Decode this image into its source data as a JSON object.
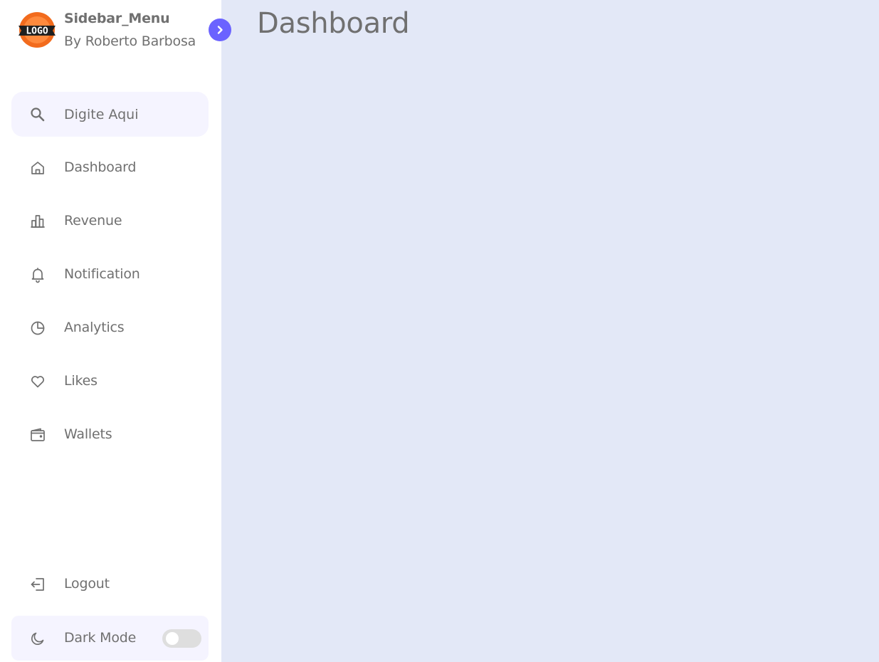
{
  "sidebar": {
    "brand": {
      "logo_text": "LOGO",
      "name": "Sidebar_Menu",
      "author": "By Roberto Barbosa"
    },
    "search": {
      "placeholder": "Digite Aqui",
      "icon": "search-icon"
    },
    "items": [
      {
        "label": "Dashboard",
        "icon": "home-icon"
      },
      {
        "label": "Revenue",
        "icon": "bar-chart-icon"
      },
      {
        "label": "Notification",
        "icon": "bell-icon"
      },
      {
        "label": "Analytics",
        "icon": "pie-chart-icon"
      },
      {
        "label": "Likes",
        "icon": "heart-icon"
      },
      {
        "label": "Wallets",
        "icon": "wallet-icon"
      }
    ],
    "logout": {
      "label": "Logout",
      "icon": "logout-icon"
    },
    "dark_mode": {
      "label": "Dark Mode",
      "icon": "moon-icon",
      "enabled": false
    }
  },
  "main": {
    "title": "Dashboard"
  },
  "colors": {
    "accent": "#6b63ff",
    "text": "#707070",
    "main_bg": "#e3e8f7",
    "highlight_bg": "#f5f4ff",
    "switch_off": "#dedede",
    "logo_orange": "#f26b1d"
  }
}
